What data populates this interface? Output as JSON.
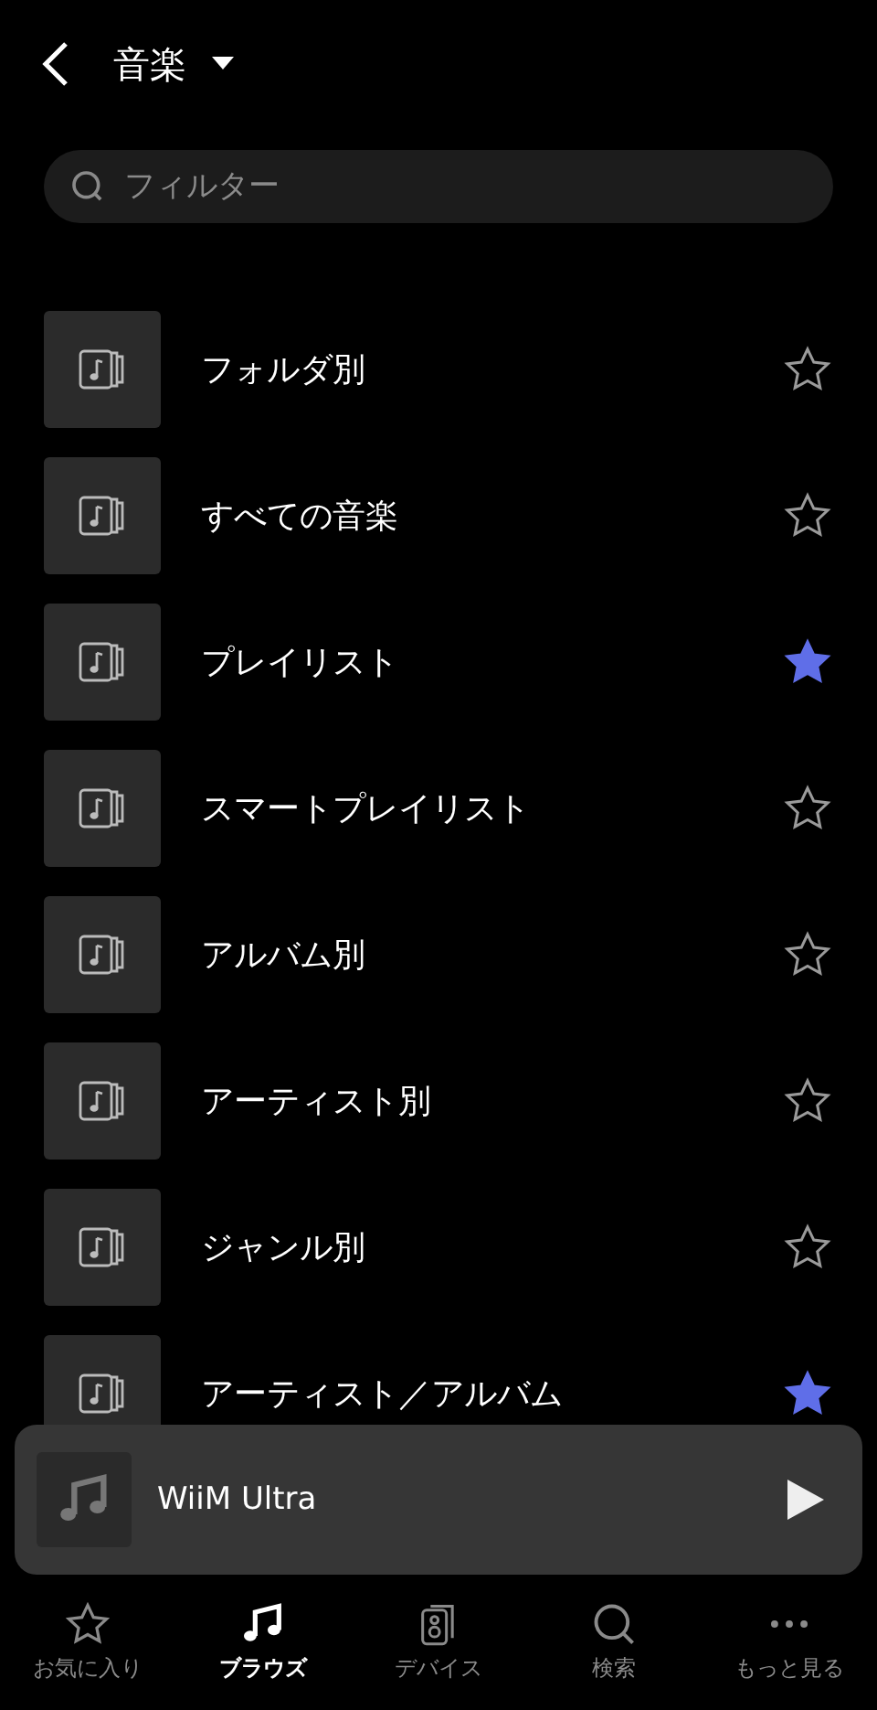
{
  "header": {
    "title": "音楽"
  },
  "search": {
    "placeholder": "フィルター"
  },
  "items": [
    {
      "label": "フォルダ別",
      "favorite": false
    },
    {
      "label": "すべての音楽",
      "favorite": false
    },
    {
      "label": "プレイリスト",
      "favorite": true
    },
    {
      "label": "スマートプレイリスト",
      "favorite": false
    },
    {
      "label": "アルバム別",
      "favorite": false
    },
    {
      "label": "アーティスト別",
      "favorite": false
    },
    {
      "label": "ジャンル別",
      "favorite": false
    },
    {
      "label": "アーティスト／アルバム",
      "favorite": true
    }
  ],
  "now_playing": {
    "device": "WiiM Ultra"
  },
  "tabs": [
    {
      "kind": "favorites",
      "label": "お気に入り",
      "selected": false
    },
    {
      "kind": "browse",
      "label": "ブラウズ",
      "selected": true
    },
    {
      "kind": "devices",
      "label": "デバイス",
      "selected": false
    },
    {
      "kind": "search",
      "label": "検索",
      "selected": false
    },
    {
      "kind": "more",
      "label": "もっと見る",
      "selected": false
    }
  ]
}
